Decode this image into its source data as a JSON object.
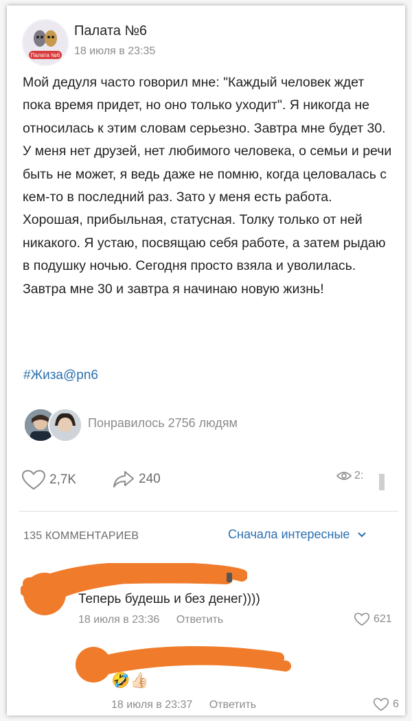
{
  "post": {
    "group_name": "Палата №6",
    "time": "18 июля в 23:35",
    "text": "Мой дедуля часто говорил мне: \"Каждый человек ждет пока время придет, но оно только уходит\". Я никогда не относилась к этим словам серьезно. Завтра мне будет 30. У меня нет друзей, нет любимого человека, о семьи и речи быть не может, я ведь даже не помню, когда целовалась с кем-то в последний раз. Зато у меня есть работа. Хорошая, прибыльная, статусная. Толку только от ней никакого. Я устаю, посвящаю себя работе, а затем рыдаю в подушку ночью. Сегодня просто взяла и уволилась. Завтра мне 30 и завтра я начинаю новую жизнь!",
    "hashtag": "#Жиза@pn6",
    "likes_text": "Понравилось 2756 людям",
    "avatar_label": "Палата №6"
  },
  "actions": {
    "likes": "2,7K",
    "shares": "240",
    "views": "2:"
  },
  "comments": {
    "count_label": "135 КОММЕНТАРИЕВ",
    "sort_label": "Сначала интересные",
    "items": [
      {
        "text": "Теперь будешь и без денег))))",
        "time": "18 июля в 23:36",
        "reply": "Ответить",
        "likes": "621"
      },
      {
        "emoji": "🤣👍🏻",
        "time": "18 июля в 23:37",
        "reply": "Ответить",
        "likes": "6"
      }
    ]
  },
  "colors": {
    "link": "#2a6fb0",
    "secondary_text": "#8b8b8b",
    "redaction": "#f07b2a"
  },
  "icons": [
    "heart-icon",
    "share-icon",
    "eye-icon",
    "chevron-down-icon"
  ]
}
